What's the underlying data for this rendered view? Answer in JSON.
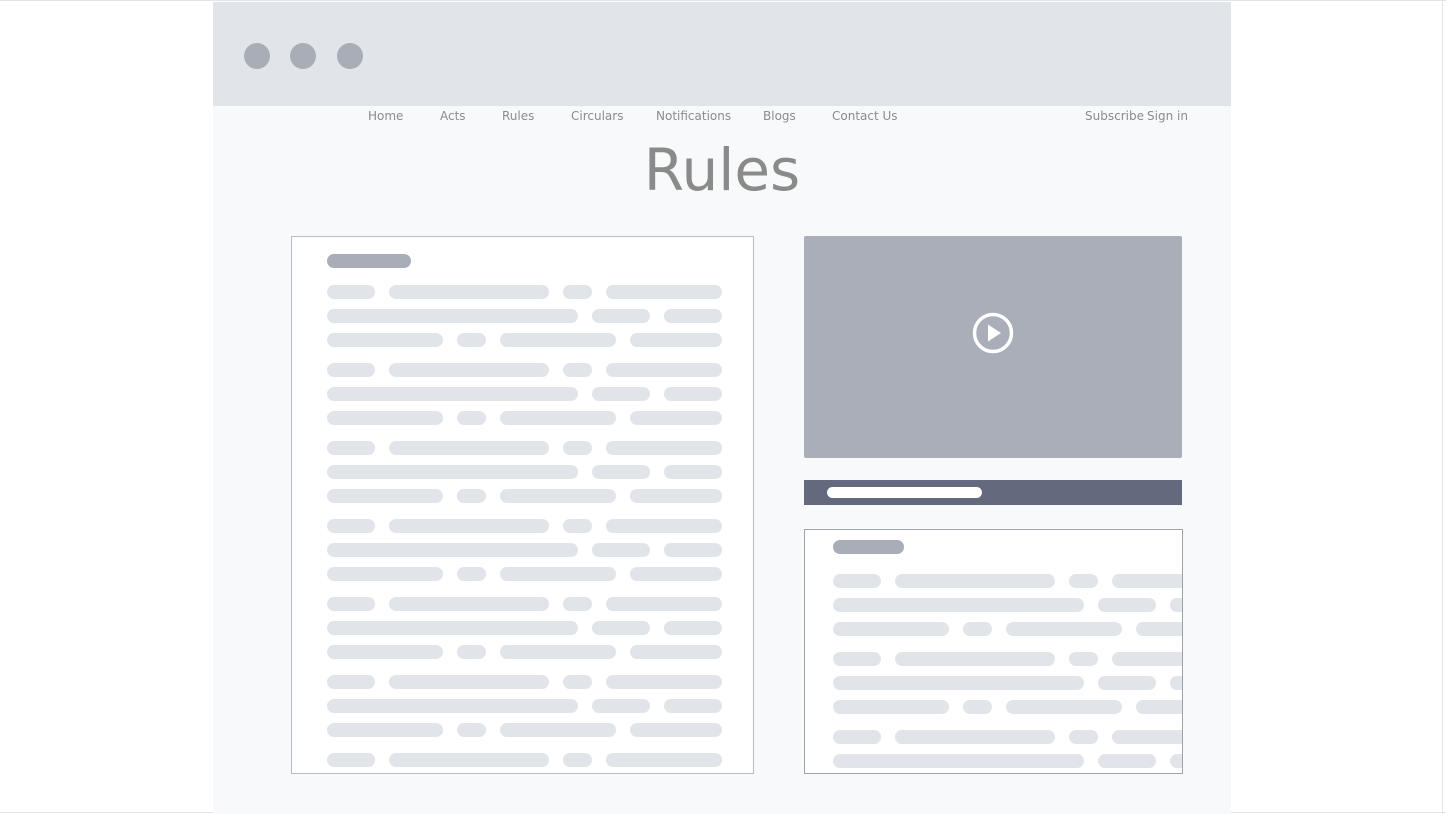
{
  "nav": {
    "items": [
      {
        "label": "Home"
      },
      {
        "label": "Acts"
      },
      {
        "label": "Rules"
      },
      {
        "label": "Circulars"
      },
      {
        "label": "Notifications"
      },
      {
        "label": "Blogs"
      },
      {
        "label": "Contact Us"
      }
    ],
    "subscribe": "Subscribe",
    "sign_in": "Sign in"
  },
  "page": {
    "title": "Rules"
  },
  "colors": {
    "window_chrome": "#e1e5ea",
    "page_background": "#f8f9fb",
    "placeholder_text": "#e1e4e8",
    "placeholder_heading": "#a8adb8",
    "video_background": "#a9aeb8",
    "caption_bar": "#636a7e"
  },
  "icons": {
    "video": "play-circle-icon"
  }
}
